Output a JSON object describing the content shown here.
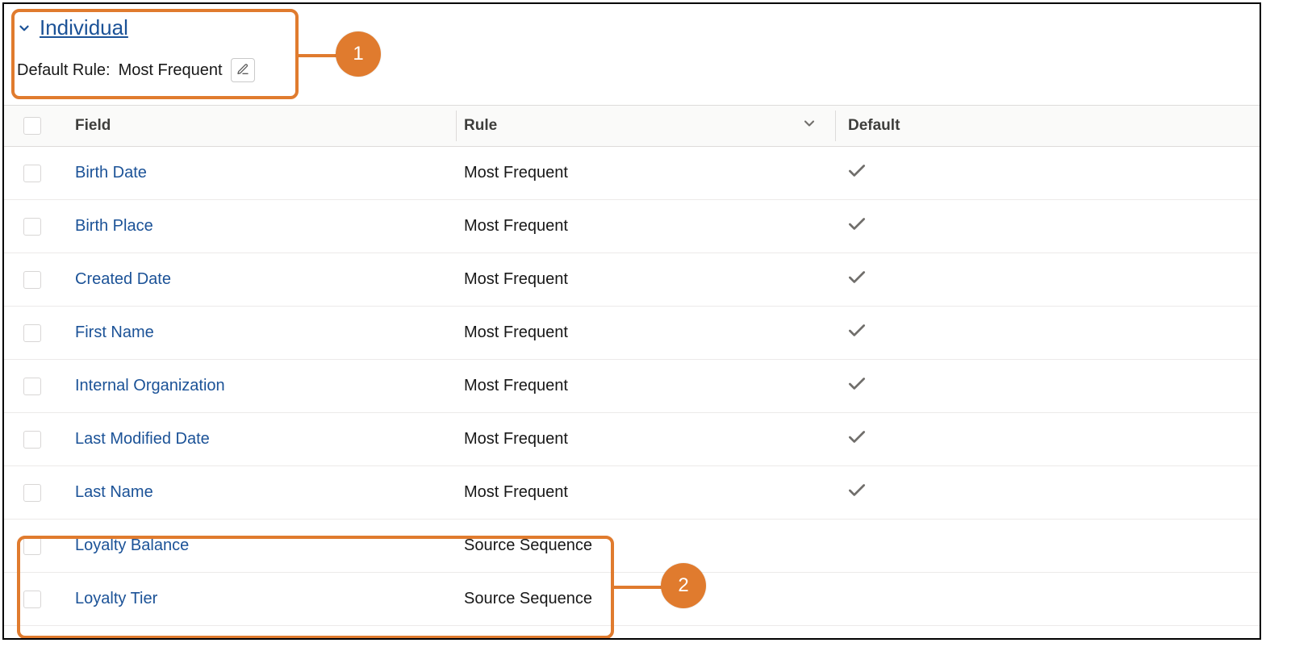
{
  "section": {
    "title": "Individual",
    "default_rule_label": "Default Rule:",
    "default_rule_value": "Most Frequent"
  },
  "table": {
    "headers": {
      "field": "Field",
      "rule": "Rule",
      "default": "Default"
    },
    "rows": [
      {
        "field": "Birth Date",
        "rule": "Most Frequent",
        "default": true
      },
      {
        "field": "Birth Place",
        "rule": "Most Frequent",
        "default": true
      },
      {
        "field": "Created Date",
        "rule": "Most Frequent",
        "default": true
      },
      {
        "field": "First Name",
        "rule": "Most Frequent",
        "default": true
      },
      {
        "field": "Internal Organization",
        "rule": "Most Frequent",
        "default": true
      },
      {
        "field": "Last Modified Date",
        "rule": "Most Frequent",
        "default": true
      },
      {
        "field": "Last Name",
        "rule": "Most Frequent",
        "default": true
      },
      {
        "field": "Loyalty Balance",
        "rule": "Source Sequence",
        "default": false
      },
      {
        "field": "Loyalty Tier",
        "rule": "Source Sequence",
        "default": false
      }
    ]
  },
  "callouts": {
    "one": "1",
    "two": "2"
  }
}
